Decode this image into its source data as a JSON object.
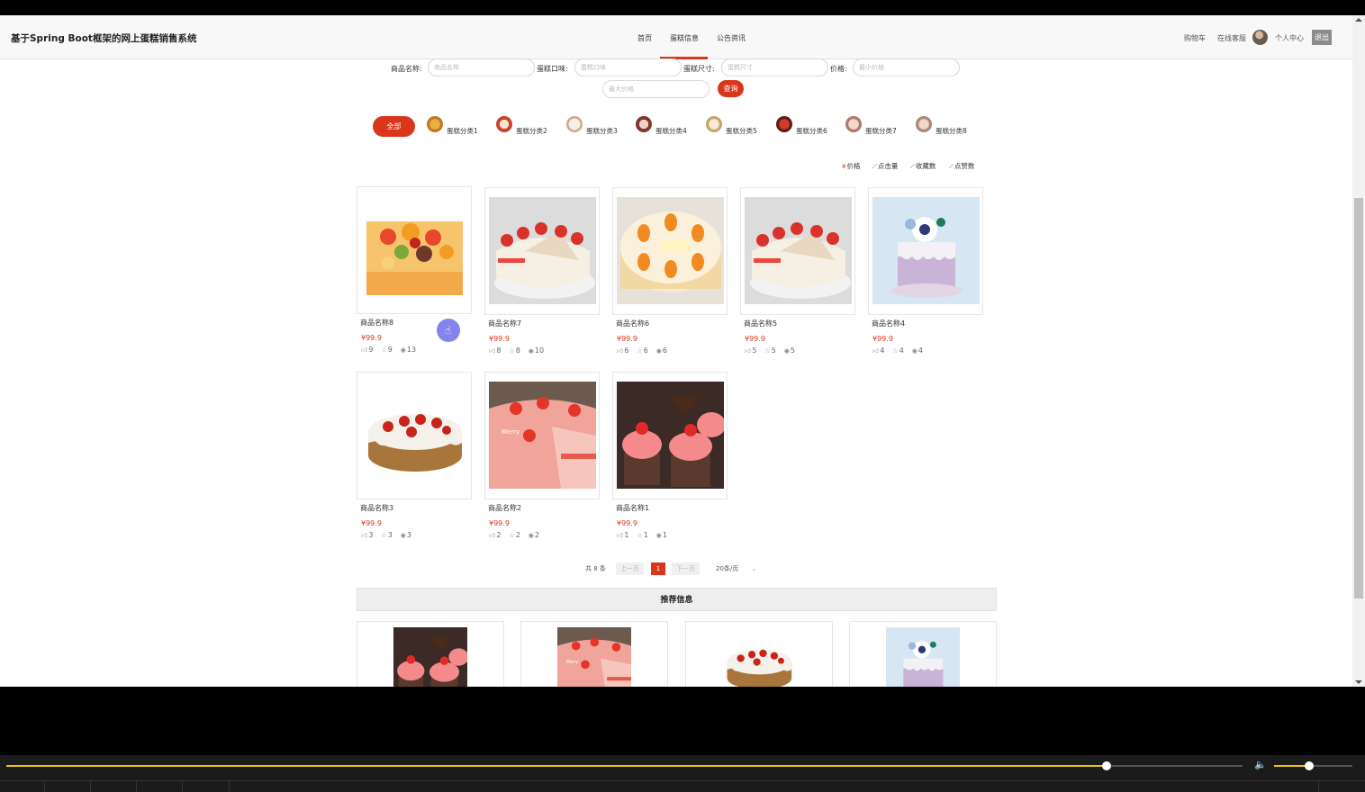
{
  "header": {
    "site_title": "基于Spring Boot框架的网上蛋糕销售系统",
    "nav": [
      {
        "label": "首页",
        "active": false
      },
      {
        "label": "蛋糕信息",
        "active": true
      },
      {
        "label": "公告资讯",
        "active": false
      }
    ],
    "cart": "购物车",
    "service": "在线客服",
    "personal": "个人中心",
    "logout": "退出"
  },
  "search": {
    "name_label": "商品名称:",
    "name_placeholder": "商品名称",
    "flavor_label": "蛋糕口味:",
    "flavor_placeholder": "蛋糕口味",
    "size_label": "蛋糕尺寸:",
    "size_placeholder": "蛋糕尺寸",
    "price_label": "价格:",
    "min_price_placeholder": "最小价格",
    "max_price_placeholder": "最大价格",
    "query_button": "查询"
  },
  "categories": {
    "all": "全部",
    "items": [
      "蛋糕分类1",
      "蛋糕分类2",
      "蛋糕分类3",
      "蛋糕分类4",
      "蛋糕分类5",
      "蛋糕分类6",
      "蛋糕分类7",
      "蛋糕分类8"
    ]
  },
  "sort": {
    "price": "价格",
    "clicks": "点击量",
    "favorites": "收藏数",
    "likes": "点赞数"
  },
  "products": [
    {
      "name": "商品名称8",
      "price": "¥99.9",
      "likes": "9",
      "stars": "9",
      "views": "13"
    },
    {
      "name": "商品名称7",
      "price": "¥99.9",
      "likes": "8",
      "stars": "8",
      "views": "10"
    },
    {
      "name": "商品名称6",
      "price": "¥99.9",
      "likes": "6",
      "stars": "6",
      "views": "6"
    },
    {
      "name": "商品名称5",
      "price": "¥99.9",
      "likes": "5",
      "stars": "5",
      "views": "5"
    },
    {
      "name": "商品名称4",
      "price": "¥99.9",
      "likes": "4",
      "stars": "4",
      "views": "4"
    },
    {
      "name": "商品名称3",
      "price": "¥99.9",
      "likes": "3",
      "stars": "3",
      "views": "3"
    },
    {
      "name": "商品名称2",
      "price": "¥99.9",
      "likes": "2",
      "stars": "2",
      "views": "2"
    },
    {
      "name": "商品名称1",
      "price": "¥99.9",
      "likes": "1",
      "stars": "1",
      "views": "1"
    }
  ],
  "pagination": {
    "total": "共 8 条",
    "prev": "上一页",
    "current": "1",
    "next": "下一页",
    "page_size": "20条/页"
  },
  "recommend": {
    "title": "推荐信息"
  },
  "player": {
    "progress": 0.89,
    "volume": 0.45
  }
}
